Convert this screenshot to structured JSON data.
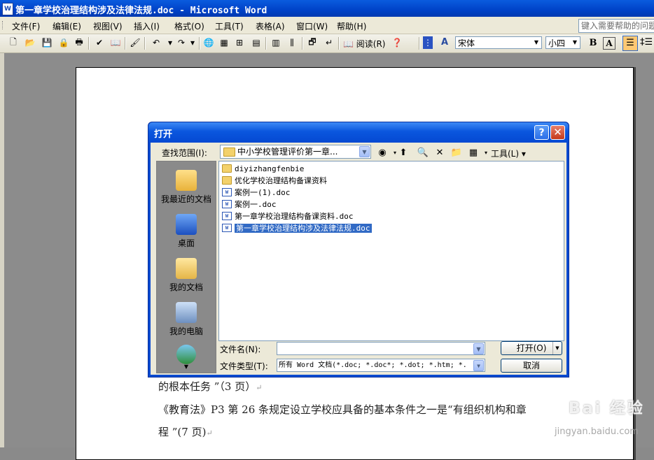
{
  "window": {
    "title": "第一章学校治理结构涉及法律法规.doc - Microsoft Word",
    "app_icon": "W"
  },
  "menubar": {
    "items": [
      "文件(F)",
      "编辑(E)",
      "视图(V)",
      "插入(I)",
      "格式(O)",
      "工具(T)",
      "表格(A)",
      "窗口(W)",
      "帮助(H)"
    ],
    "help_placeholder": "键入需要帮助的问题"
  },
  "toolbar": {
    "read_label": "阅读(R)",
    "font_name": "宋体",
    "font_size": "小四",
    "bold_label": "B",
    "char_border_label": "A"
  },
  "document": {
    "lines": [
      "的根本任务 ”（3 页）",
      "《教育法》P3 第 26 条规定设立学校应具备的基本条件之一是“有组织机构和章",
      "程 ”(7 页)"
    ]
  },
  "dialog": {
    "title": "打开",
    "help_button": "?",
    "close_button": "✕",
    "lookin_label": "查找范围(I):",
    "lookin_value": "中小学校管理评价第一章...",
    "tools_label": "工具(L)",
    "places": [
      "我最近的文档",
      "桌面",
      "我的文档",
      "我的电脑"
    ],
    "files": [
      {
        "name": "diyizhangfenbie",
        "type": "folder",
        "selected": false
      },
      {
        "name": "优化学校治理结构备课资料",
        "type": "folder",
        "selected": false
      },
      {
        "name": "案例一(1).doc",
        "type": "doc",
        "selected": false
      },
      {
        "name": "案例一.doc",
        "type": "doc",
        "selected": false
      },
      {
        "name": "第一章学校治理结构备课资料.doc",
        "type": "doc",
        "selected": false
      },
      {
        "name": "第一章学校治理结构涉及法律法规.doc",
        "type": "doc",
        "selected": true
      }
    ],
    "filename_label": "文件名(N):",
    "filename_value": "",
    "filetype_label": "文件类型(T):",
    "filetype_value": "所有 Word 文档(*.doc; *.doc*; *.dot; *.htm; *.",
    "open_button": "打开(O)",
    "cancel_button": "取消"
  },
  "watermark": {
    "cn": "Bai 经验",
    "en": "jingyan.baidu.com"
  }
}
